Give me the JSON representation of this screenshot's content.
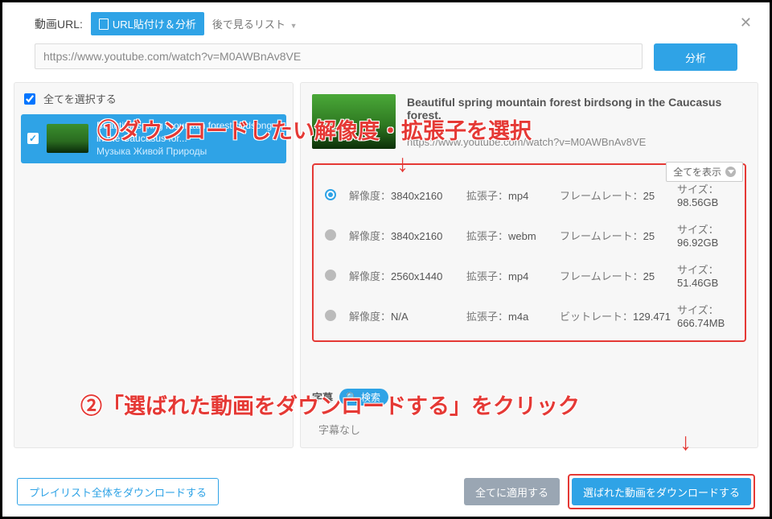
{
  "topbar": {
    "url_label": "動画URL:",
    "paste_btn": "URL貼付け＆分析",
    "later_list": "後で見るリスト",
    "url_value": "https://www.youtube.com/watch?v=M0AWBnAv8VE",
    "analyze_btn": "分析"
  },
  "left": {
    "select_all": "全てを選択する",
    "item": {
      "title_line1": "Beautiful spring mountain forest birdsong",
      "title_line2": "in the Caucasus for...",
      "title_line3": "Музыка Живой Природы"
    }
  },
  "right": {
    "title": "Beautiful spring mountain forest birdsong in the Caucasus forest.",
    "url": "https://www.youtube.com/watch?v=M0AWBnAv8VE",
    "show_all": "全てを表示"
  },
  "formats": [
    {
      "selected": true,
      "res": "3840x2160",
      "ext": "mp4",
      "rate_label": "フレームレート：",
      "rate": "25",
      "size": "98.56GB"
    },
    {
      "selected": false,
      "res": "3840x2160",
      "ext": "webm",
      "rate_label": "フレームレート：",
      "rate": "25",
      "size": "96.92GB"
    },
    {
      "selected": false,
      "res": "2560x1440",
      "ext": "mp4",
      "rate_label": "フレームレート：",
      "rate": "25",
      "size": "51.46GB"
    },
    {
      "selected": false,
      "res": "N/A",
      "ext": "m4a",
      "rate_label": "ビットレート：",
      "rate": "129.471",
      "size": "666.74MB"
    }
  ],
  "labels": {
    "res": "解像度：",
    "ext": "拡張子：",
    "size": "サイズ："
  },
  "subtitles": {
    "label": "字幕",
    "search": "検索",
    "none": "字幕なし"
  },
  "bottom": {
    "dl_playlist": "プレイリスト全体をダウンロードする",
    "apply_all": "全てに適用する",
    "dl_selected": "選ばれた動画をダウンロードする"
  },
  "annotations": {
    "step1": "①ダウンロードしたい解像度・拡張子を選択",
    "step2": "②「選ばれた動画をダウンロードする」をクリック",
    "arrow": "↓"
  }
}
